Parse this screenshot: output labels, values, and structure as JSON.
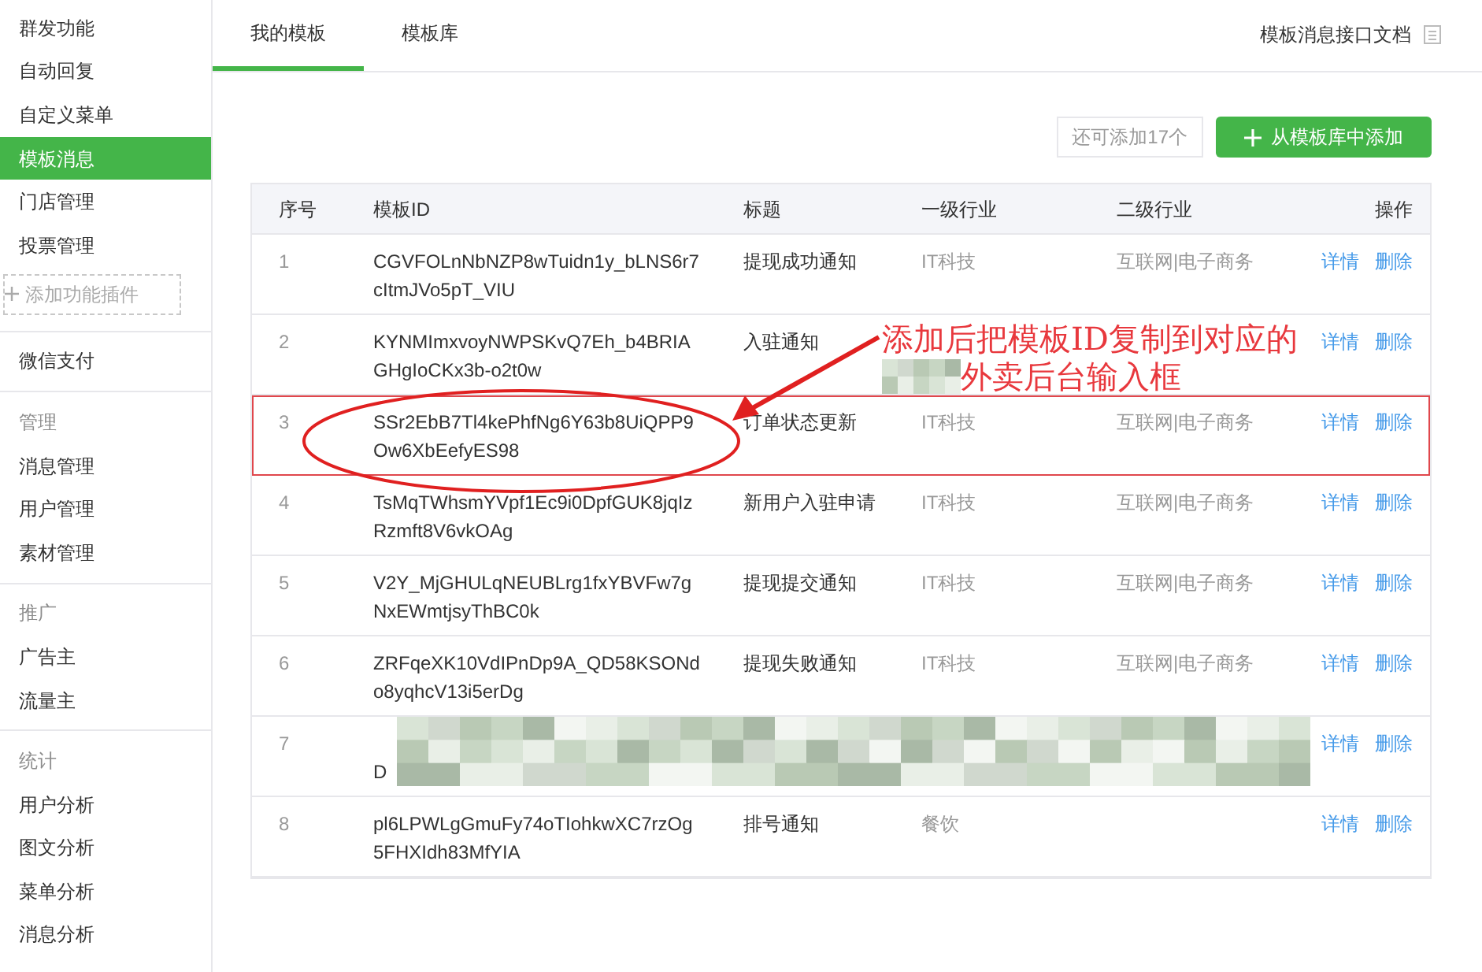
{
  "sidebar": {
    "sections": [
      {
        "items": [
          {
            "label": "群发功能",
            "selected": false
          },
          {
            "label": "自动回复",
            "selected": false
          },
          {
            "label": "自定义菜单",
            "selected": false
          },
          {
            "label": "模板消息",
            "selected": true
          },
          {
            "label": "门店管理",
            "selected": false
          },
          {
            "label": "投票管理",
            "selected": false
          }
        ],
        "add_plugin": "添加功能插件"
      },
      {
        "items": [
          {
            "label": "微信支付",
            "selected": false
          }
        ]
      },
      {
        "heading": "管理",
        "items": [
          {
            "label": "消息管理",
            "selected": false
          },
          {
            "label": "用户管理",
            "selected": false
          },
          {
            "label": "素材管理",
            "selected": false
          }
        ]
      },
      {
        "heading": "推广",
        "items": [
          {
            "label": "广告主",
            "selected": false
          },
          {
            "label": "流量主",
            "selected": false
          }
        ]
      },
      {
        "heading": "统计",
        "items": [
          {
            "label": "用户分析",
            "selected": false
          },
          {
            "label": "图文分析",
            "selected": false
          },
          {
            "label": "菜单分析",
            "selected": false
          },
          {
            "label": "消息分析",
            "selected": false
          }
        ]
      }
    ]
  },
  "tabs": [
    {
      "label": "我的模板",
      "selected": true
    },
    {
      "label": "模板库",
      "selected": false
    }
  ],
  "doc_link": "模板消息接口文档",
  "quota": "还可添加17个",
  "add_button": "从模板库中添加",
  "table": {
    "columns": [
      "序号",
      "模板ID",
      "标题",
      "一级行业",
      "二级行业",
      "操作"
    ],
    "rows": [
      {
        "kind": "normal",
        "no": "1",
        "id": [
          "CGVFOLnNbNZP8wTuidn1y_bLNS6r7",
          "cItmJVo5pT_VIU"
        ],
        "title": "提现成功通知",
        "industry_1": "IT科技",
        "industry_2": "互联网|电子商务",
        "actions": [
          "详情",
          "删除"
        ],
        "highlighted": false
      },
      {
        "kind": "normal",
        "no": "2",
        "id": [
          "KYNMImxvoyNWPSKvQ7Eh_b4BRIA",
          "GHgIoCKx3b-o2t0w"
        ],
        "title": "入驻通知",
        "actions": [
          "详情",
          "删除"
        ],
        "highlighted": false
      },
      {
        "kind": "normal",
        "no": "3",
        "id": [
          "SSr2EbB7Tl4kePhfNg6Y63b8UiQPP9",
          "Ow6XbEefyES98"
        ],
        "title": "订单状态更新",
        "industry_1": "IT科技",
        "industry_2": "互联网|电子商务",
        "actions": [
          "详情",
          "删除"
        ],
        "highlighted": true
      },
      {
        "kind": "normal",
        "no": "4",
        "id": [
          "TsMqTWhsmYVpf1Ec9i0DpfGUK8jqIz",
          "Rzmft8V6vkOAg"
        ],
        "title": "新用户入驻申请",
        "industry_1": "IT科技",
        "industry_2": "互联网|电子商务",
        "actions": [
          "详情",
          "删除"
        ],
        "highlighted": false
      },
      {
        "kind": "normal",
        "no": "5",
        "id": [
          "V2Y_MjGHULqNEUBLrg1fxYBVFw7g",
          "NxEWmtjsyThBC0k"
        ],
        "title": "提现提交通知",
        "industry_1": "IT科技",
        "industry_2": "互联网|电子商务",
        "actions": [
          "详情",
          "删除"
        ],
        "highlighted": false
      },
      {
        "kind": "normal",
        "no": "6",
        "id": [
          "ZRFqeXK10VdIPnDp9A_QD58KSONd",
          "o8yqhcV13i5erDg"
        ],
        "title": "提现失败通知",
        "industry_1": "IT科技",
        "industry_2": "互联网|电子商务",
        "actions": [
          "详情",
          "删除"
        ],
        "highlighted": false
      },
      {
        "kind": "redacted",
        "no": "7",
        "id": [
          "D"
        ],
        "actions": [
          "详情",
          "删除"
        ],
        "highlighted": false
      },
      {
        "kind": "normal",
        "no": "8",
        "id": [
          "pl6LPWLgGmuFy74oTIohkwXC7rzOg",
          "5FHXIdh83MfYIA"
        ],
        "title": "排号通知",
        "industry_1": "餐饮",
        "actions": [
          "详情",
          "删除"
        ],
        "highlighted": false
      }
    ]
  },
  "annotation": {
    "lines": [
      "添加后把模板ID复制到对应的",
      "外卖后台输入框"
    ]
  }
}
